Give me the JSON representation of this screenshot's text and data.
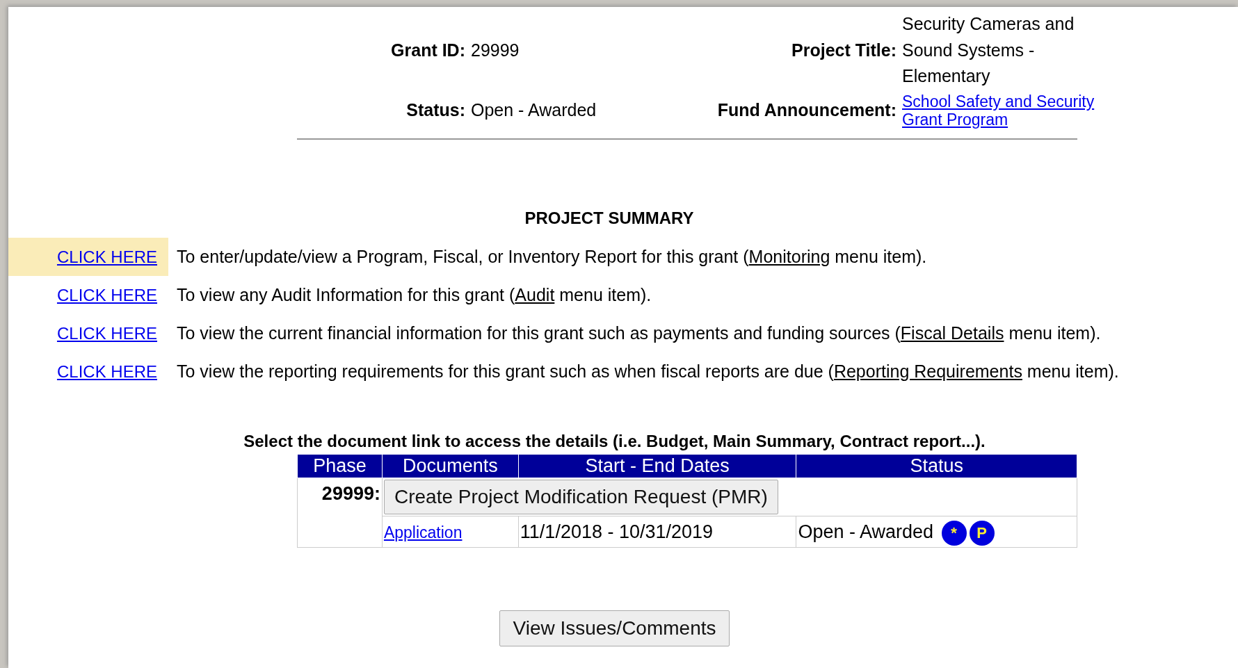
{
  "header": {
    "grant_id_label": "Grant ID:",
    "grant_id": "29999",
    "project_title_label": "Project Title:",
    "project_title": "Security Cameras and Sound Systems - Elementary",
    "status_label": "Status:",
    "status": "Open - Awarded",
    "fund_label": "Fund Announcement:",
    "fund_link": "School Safety and Security Grant Program"
  },
  "summary": {
    "title": "PROJECT SUMMARY",
    "rows": [
      {
        "link": "CLICK HERE",
        "highlighted": true,
        "before": "To enter/update/view a Program, Fiscal, or Inventory Report for this grant (",
        "menu_item": "Monitoring",
        "after": " menu item)."
      },
      {
        "link": "CLICK HERE",
        "highlighted": false,
        "before": "To view any Audit Information for this grant (",
        "menu_item": "Audit",
        "after": " menu item)."
      },
      {
        "link": "CLICK HERE",
        "highlighted": false,
        "before": "To view the current financial information for this grant such as payments and funding sources (",
        "menu_item": "Fiscal Details",
        "after": " menu item)."
      },
      {
        "link": "CLICK HERE",
        "highlighted": false,
        "before": "To view the reporting requirements for this grant such as when fiscal reports are due (",
        "menu_item": "Reporting Requirements",
        "after": " menu item)."
      }
    ]
  },
  "documents": {
    "instruction": "Select the document link to access the details (i.e. Budget, Main Summary, Contract report...).",
    "columns": [
      "Phase",
      "Documents",
      "Start - End Dates",
      "Status"
    ],
    "phase": "29999:",
    "pmr_button": "Create Project Modification Request (PMR)",
    "rows": [
      {
        "document": "Application",
        "dates": "11/1/2018 - 10/31/2019",
        "status": "Open - Awarded",
        "badges": [
          "*",
          "P"
        ]
      }
    ]
  },
  "footer_button": "View Issues/Comments"
}
